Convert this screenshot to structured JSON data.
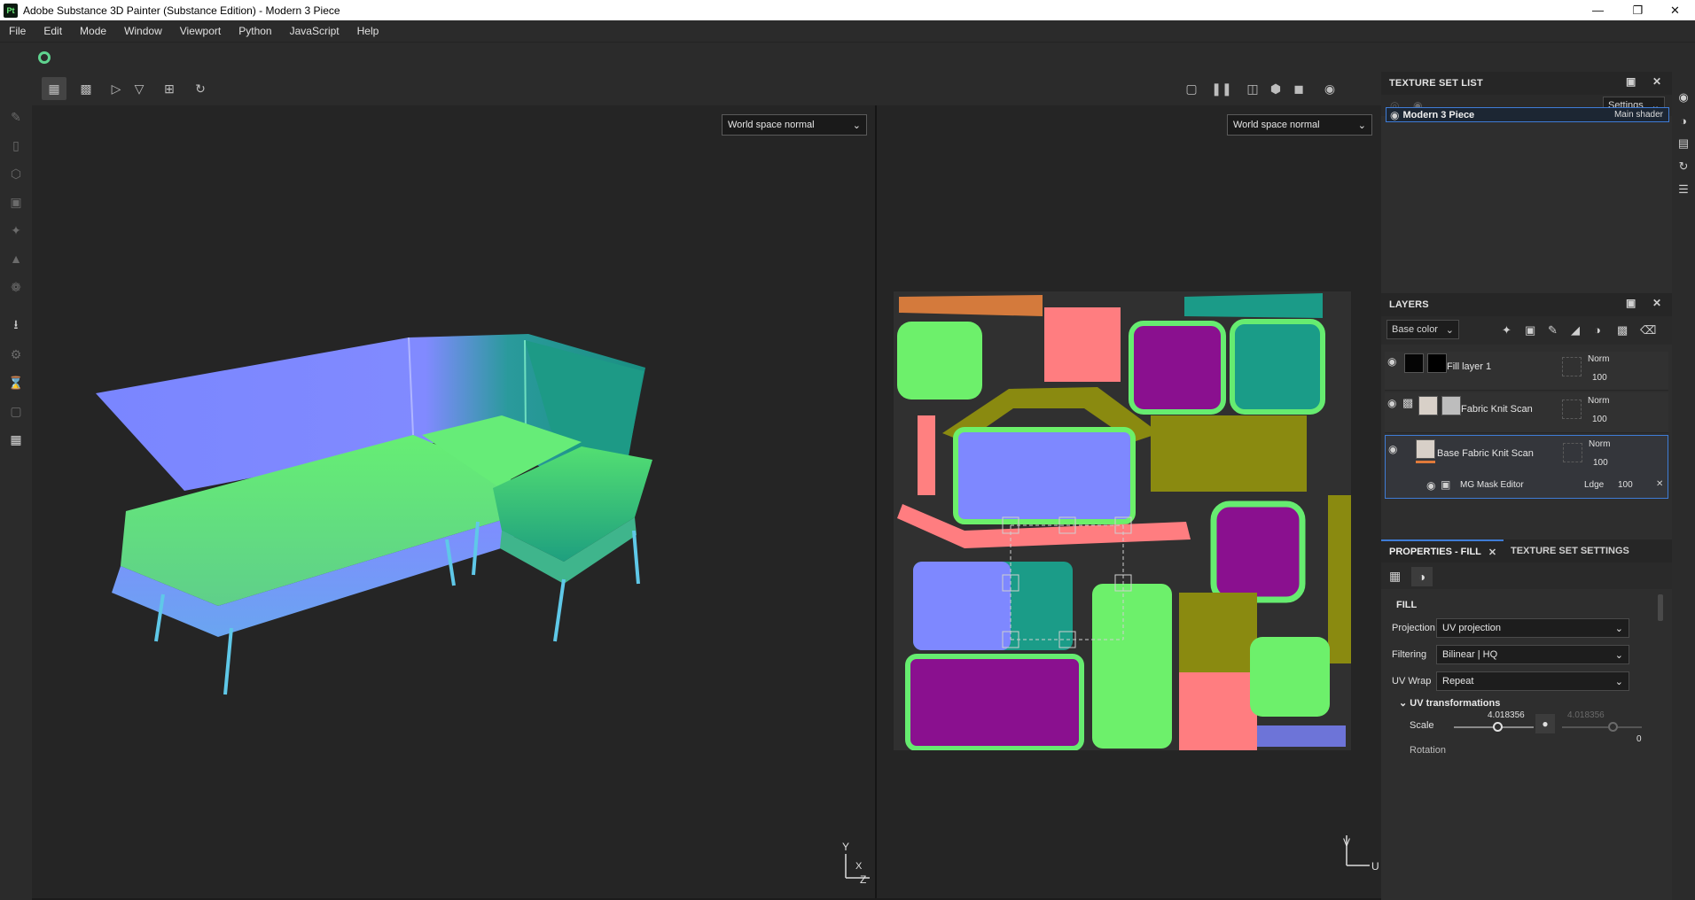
{
  "window": {
    "app_icon": "Pt",
    "title": "Adobe Substance 3D Painter (Substance Edition) - Modern 3 Piece",
    "minimize_icon": "minimize-icon",
    "restore_icon": "restore-icon",
    "close_icon": "close-icon"
  },
  "menu": [
    "File",
    "Edit",
    "Mode",
    "Window",
    "Viewport",
    "Python",
    "JavaScript",
    "Help"
  ],
  "viewport3d": {
    "channel": "World space normal",
    "axis_y": "Y",
    "axis_x": "X",
    "axis_z": "Z"
  },
  "viewport2d": {
    "channel": "World space normal",
    "axis_v": "V",
    "axis_u": "U"
  },
  "texture_set_list": {
    "title": "TEXTURE SET LIST",
    "settings_label": "Settings",
    "item_name": "Modern 3 Piece",
    "item_shader": "Main shader"
  },
  "layers": {
    "title": "LAYERS",
    "channel": "Base color",
    "rows": [
      {
        "name": "Fill layer 1",
        "blend": "Norm",
        "opacity": "100"
      },
      {
        "name": "Fabric Knit Scan",
        "blend": "Norm",
        "opacity": "100"
      },
      {
        "name": "Base Fabric Knit Scan",
        "blend": "Norm",
        "opacity": "100"
      }
    ],
    "effect": {
      "name": "MG Mask Editor",
      "blend": "Ldge",
      "opacity": "100"
    }
  },
  "properties": {
    "tab_fill": "PROPERTIES - FILL",
    "tab_texture": "TEXTURE SET SETTINGS",
    "section": "FILL",
    "projection_label": "Projection",
    "projection_value": "UV projection",
    "filtering_label": "Filtering",
    "filtering_value": "Bilinear | HQ",
    "uvwrap_label": "UV Wrap",
    "uvwrap_value": "Repeat",
    "uv_section": "UV transformations",
    "scale_label": "Scale",
    "scale_value": "4.018356",
    "scale_value2": "4.018356",
    "rotation_label": "Rotation",
    "rotation_value": "0"
  },
  "colors": {
    "accent": "#1e6fd9",
    "normal_blue": "#7f86ff",
    "normal_green": "#6ff06a",
    "normal_teal": "#1b9a86",
    "normal_magenta": "#8a0f98",
    "normal_pink": "#ff7a7a",
    "normal_olive": "#8a8a10"
  }
}
